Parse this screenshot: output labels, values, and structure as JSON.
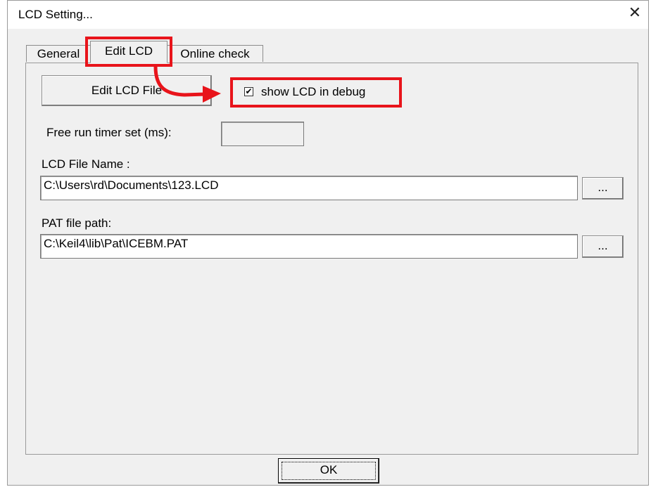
{
  "window": {
    "title": "LCD Setting...",
    "close_glyph": "✕"
  },
  "tabs": [
    {
      "label": "General"
    },
    {
      "label": "Edit LCD",
      "active": true
    },
    {
      "label": "Online check"
    }
  ],
  "panel": {
    "edit_lcd_file_button": "Edit LCD File",
    "show_lcd_checkbox": {
      "label": "show LCD in debug",
      "checked": true,
      "check_glyph": "✔"
    },
    "free_run_timer": {
      "label": "Free run timer set (ms):",
      "value": ""
    },
    "lcd_file_name": {
      "label": "LCD File Name :",
      "value": "C:\\Users\\rd\\Documents\\123.LCD",
      "browse_label": "..."
    },
    "pat_file_path": {
      "label": "PAT file path:",
      "value": "C:\\Keil4\\lib\\Pat\\ICEBM.PAT",
      "browse_label": "..."
    }
  },
  "footer": {
    "ok_label": "OK"
  },
  "annotation": {
    "highlight_color": "#e8141b"
  }
}
